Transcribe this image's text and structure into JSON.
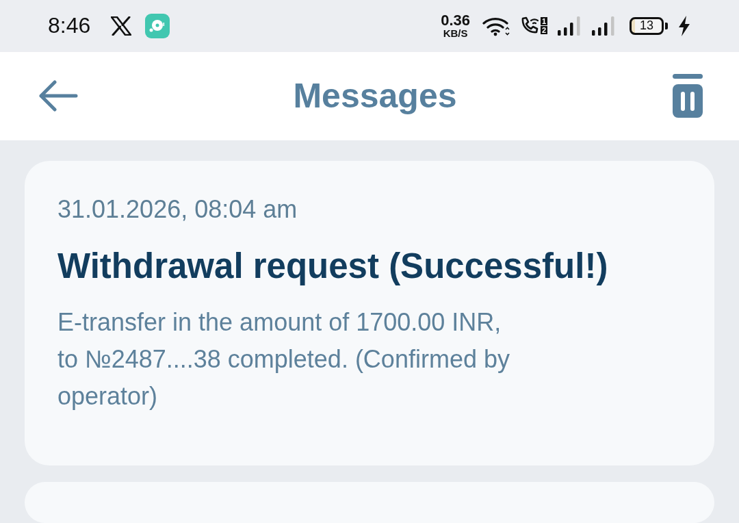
{
  "status_bar": {
    "time": "8:46",
    "speed_value": "0.36",
    "speed_unit": "KB/S",
    "sim_labels": [
      "1",
      "2"
    ],
    "battery": "13"
  },
  "header": {
    "title": "Messages"
  },
  "messages": [
    {
      "date": "31.01.2026, 08:04 am",
      "title": "Withdrawal request (Successful!)",
      "body": "E-transfer in the amount of 1700.00 INR,\nto №2487....38  completed. (Confirmed by operator)"
    }
  ]
}
